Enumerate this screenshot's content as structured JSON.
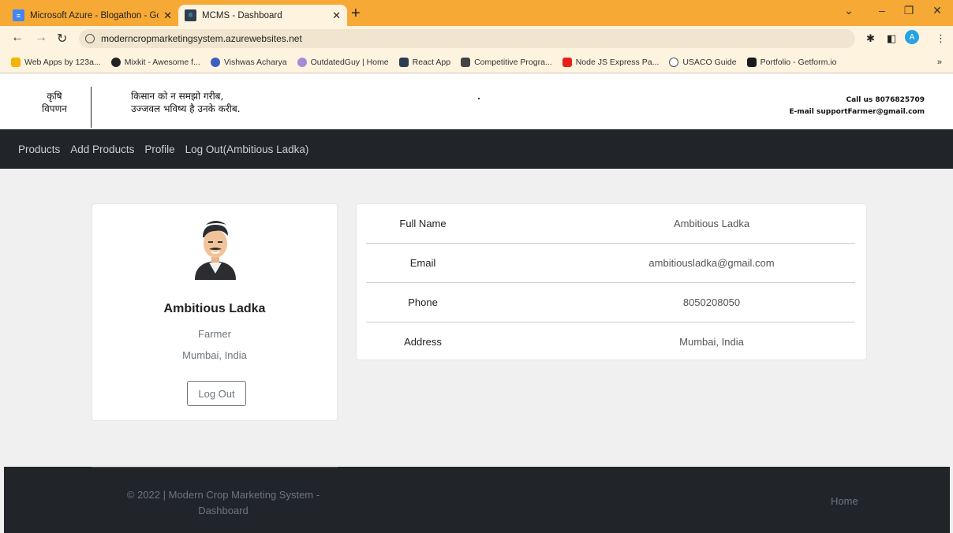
{
  "browser": {
    "tabs": [
      {
        "title": "Microsoft Azure - Blogathon - Go",
        "active": false,
        "favicon_color": "#4285f4"
      },
      {
        "title": "MCMS - Dashboard",
        "active": true,
        "favicon_color": "#2d3e50"
      }
    ],
    "url": "moderncropmarketingsystem.azurewebsites.net",
    "profile_initial": "A",
    "bookmarks": [
      {
        "label": "Web Apps by 123a...",
        "color": "#f4b400"
      },
      {
        "label": "Mixkit - Awesome f...",
        "color": "#222222"
      },
      {
        "label": "Vishwas Acharya",
        "color": "#3b5fc0"
      },
      {
        "label": "OutdatedGuy | Home",
        "color": "#a58bd6"
      },
      {
        "label": "React App",
        "color": "#2d3e50"
      },
      {
        "label": "Competitive Progra...",
        "color": "#444444"
      },
      {
        "label": "Node JS Express Pa...",
        "color": "#e62117"
      },
      {
        "label": "USACO Guide",
        "color": "#555555"
      },
      {
        "label": "Portfolio - Getform.io",
        "color": "#1b1b1b"
      }
    ],
    "more_bookmarks": "»"
  },
  "header": {
    "brand_line1": "कृषि",
    "brand_line2": "विपणन",
    "slogan_line1": "किसान को न समझो गरीब,",
    "slogan_line2": "उज्जवल भविष्य है उनके करीब.",
    "phone": "Call us 8076825709",
    "email": "E-mail supportFarmer@gmail.com"
  },
  "nav": {
    "products": "Products",
    "add_products": "Add Products",
    "profile": "Profile",
    "logout": "Log Out(Ambitious Ladka)"
  },
  "profile": {
    "name": "Ambitious Ladka",
    "role": "Farmer",
    "location": "Mumbai, India",
    "logout_button": "Log Out"
  },
  "details": [
    {
      "label": "Full Name",
      "value": "Ambitious Ladka"
    },
    {
      "label": "Email",
      "value": "ambitiousladka@gmail.com"
    },
    {
      "label": "Phone",
      "value": "8050208050"
    },
    {
      "label": "Address",
      "value": "Mumbai, India"
    }
  ],
  "footer": {
    "copyright_line1": "© 2022 | Modern Crop Marketing System -",
    "copyright_line2": "Dashboard",
    "home_link": "Home"
  }
}
